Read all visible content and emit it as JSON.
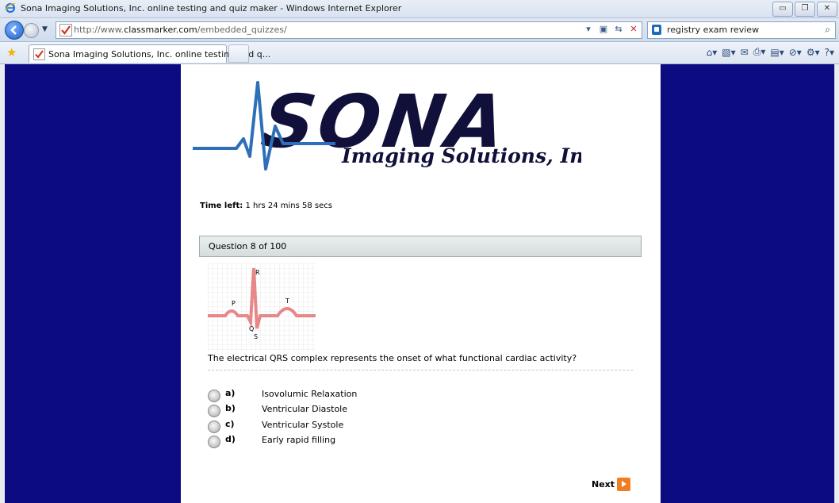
{
  "window": {
    "title": "Sona Imaging Solutions, Inc. online testing and quiz maker - Windows Internet Explorer",
    "controls": [
      "minimize",
      "restore",
      "close"
    ]
  },
  "address_bar": {
    "url_prefix": "http://www.",
    "url_domain": "classmarker.com",
    "url_path": "/embedded_quizzes/",
    "search_value": "registry exam review"
  },
  "tab": {
    "label": "Sona Imaging Solutions, Inc. online testing and q..."
  },
  "logo": {
    "wordmark": "SONA",
    "tagline": "Imaging Solutions, Inc."
  },
  "timer": {
    "label": "Time left:",
    "value": "1 hrs 24 mins 58 secs"
  },
  "question": {
    "header": "Question 8 of 100",
    "text": "The electrical QRS complex represents the onset of what functional cardiac activity?",
    "ecg_labels": [
      "P",
      "Q",
      "R",
      "S",
      "T"
    ]
  },
  "answers": [
    {
      "letter": "a)",
      "text": "Isovolumic Relaxation"
    },
    {
      "letter": "b)",
      "text": "Ventricular Diastole"
    },
    {
      "letter": "c)",
      "text": "Ventricular Systole"
    },
    {
      "letter": "d)",
      "text": "Early rapid filling"
    }
  ],
  "next_label": "Next",
  "colors": {
    "page_background": "#0c0b82",
    "logo_navy": "#10103a",
    "logo_blue": "#2d6fb8",
    "next_orange": "#f17d22"
  }
}
